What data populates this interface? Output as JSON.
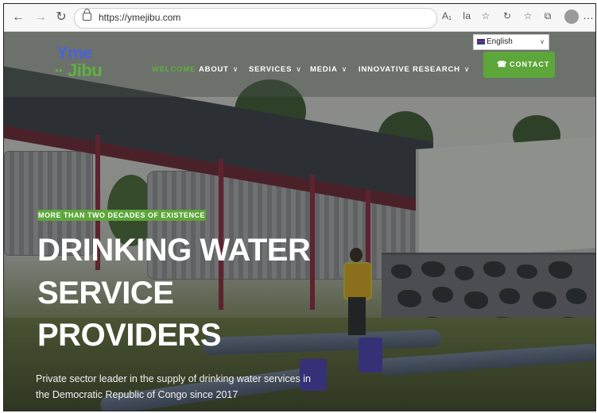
{
  "browser": {
    "url": "https://ymejibu.com",
    "icons": [
      "back-arrow-icon",
      "forward-arrow-icon",
      "reload-icon",
      "lock-icon",
      "read-aloud-icon",
      "translate-icon",
      "favorite-star-icon",
      "collections-icon",
      "favorites-icon",
      "extensions-icon",
      "profile-avatar-icon",
      "more-icon"
    ]
  },
  "site": {
    "logo": {
      "line1": "Yme",
      "line2": "Jibu"
    },
    "language": {
      "selected": "English"
    },
    "menu": [
      {
        "label": "WELCOME",
        "active": true,
        "has_dropdown": false
      },
      {
        "label": "ABOUT",
        "active": false,
        "has_dropdown": true
      },
      {
        "label": "SERVICES",
        "active": false,
        "has_dropdown": true
      },
      {
        "label": "MEDIA",
        "active": false,
        "has_dropdown": true
      },
      {
        "label": "INNOVATIVE RESEARCH",
        "active": false,
        "has_dropdown": true
      }
    ],
    "contact_label": "CONTACT"
  },
  "hero": {
    "tagline": "MORE THAN TWO DECADES OF EXISTENCE",
    "headline": [
      "DRINKING WATER",
      "SERVICE",
      "PROVIDERS"
    ],
    "subtitle": [
      "Private sector leader in the supply of drinking water services in",
      "the Democratic Republic of Congo since 2017"
    ]
  },
  "colors": {
    "accent_green": "#5ca63a",
    "logo_blue": "#4a63d6",
    "logo_green": "#5fb23a"
  }
}
